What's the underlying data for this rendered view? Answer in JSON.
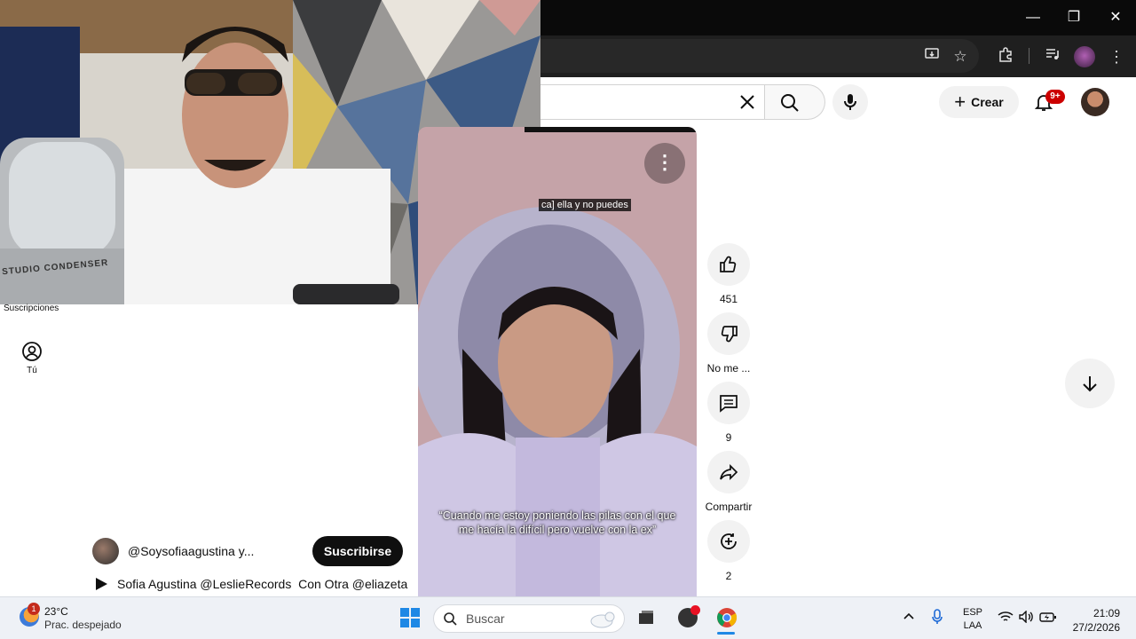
{
  "browser": {
    "window_controls": {
      "minimize": "—",
      "restore": "❐",
      "close": "✕"
    },
    "toolbar_icons": [
      "install-app-icon",
      "bookmark-star-icon",
      "extensions-icon",
      "media-control-icon",
      "profile-icon",
      "menu-dots-icon"
    ]
  },
  "youtube_header": {
    "create_label": "Crear",
    "notifications_badge": "9+"
  },
  "sidebar": {
    "subscriptions_label": "Suscripciones",
    "you_label": "Tú"
  },
  "short": {
    "caption_top": "ca] ella y no puedes",
    "caption_bottom": "“Cuando me estoy poniendo las pilas con  el que me hacía la difícil pero vuelve con la ex”",
    "channel_name": "@Soysofiaagustina y...",
    "subscribe_label": "Suscribirse",
    "music_credit": "Sofia Agustina @LeslieRecords  Con Otra @eliazeta",
    "actions": {
      "likes": "451",
      "dislike_label": "No me ...",
      "comments": "9",
      "share_label": "Compartir",
      "remix": "2"
    }
  },
  "webcam": {
    "mic_label": "STUDIO CONDENSER"
  },
  "taskbar": {
    "weather_badge": "1",
    "temperature": "23°C",
    "condition": "Prac. despejado",
    "search_placeholder": "Buscar",
    "language_top": "ESP",
    "language_bottom": "LAA",
    "time": "21:09",
    "date": "27/2/2026"
  }
}
